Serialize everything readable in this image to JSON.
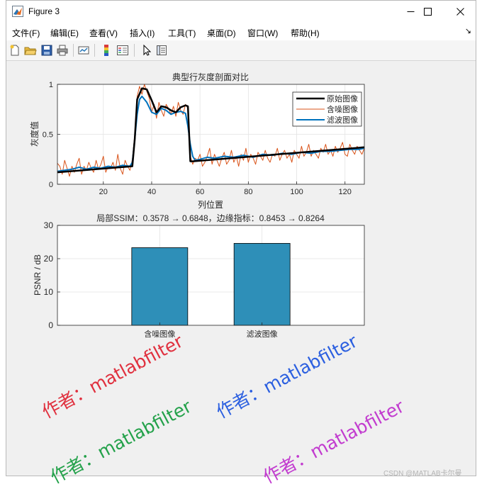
{
  "window": {
    "title": "Figure 3",
    "controls": [
      "minimize",
      "maximize",
      "close"
    ]
  },
  "menubar": {
    "items": [
      "文件(F)",
      "编辑(E)",
      "查看(V)",
      "插入(I)",
      "工具(T)",
      "桌面(D)",
      "窗口(W)",
      "帮助(H)"
    ],
    "overflow_glyph": "↘"
  },
  "toolbar": {
    "icons": [
      "new-figure-icon",
      "open-folder-icon",
      "save-icon",
      "print-icon",
      "link-icon",
      "colorbar-icon",
      "legend-icon",
      "pointer-icon",
      "property-editor-icon"
    ]
  },
  "colors": {
    "original": "#000000",
    "noisy": "#d95319",
    "filtered": "#0072bd",
    "bar": "#2e8fb8"
  },
  "chart_data": [
    {
      "type": "line",
      "title": "典型行灰度剖面对比",
      "xlabel": "列位置",
      "ylabel": "灰度值",
      "xlim": [
        1,
        128
      ],
      "ylim": [
        0,
        1
      ],
      "xticks": [
        20,
        40,
        60,
        80,
        100,
        120
      ],
      "yticks": [
        0,
        0.5,
        1
      ],
      "ytick_labels": [
        "0",
        "0.5",
        "1"
      ],
      "grid": true,
      "legend": {
        "position": "top-right",
        "entries": [
          "原始图像",
          "含噪图像",
          "滤波图像"
        ]
      },
      "series": [
        {
          "name": "原始图像",
          "x": [
            1,
            32,
            33,
            34,
            36,
            38,
            40,
            42,
            44,
            46,
            48,
            50,
            52,
            54,
            55,
            56,
            57,
            128
          ],
          "y": [
            0.12,
            0.18,
            0.45,
            0.85,
            0.96,
            0.95,
            0.84,
            0.72,
            0.78,
            0.77,
            0.74,
            0.72,
            0.77,
            0.79,
            0.78,
            0.23,
            0.23,
            0.37
          ]
        },
        {
          "name": "含噪图像",
          "x": [
            1,
            2,
            3,
            4,
            5,
            6,
            7,
            8,
            9,
            10,
            11,
            12,
            13,
            14,
            15,
            16,
            17,
            18,
            19,
            20,
            21,
            22,
            23,
            24,
            25,
            26,
            27,
            28,
            29,
            30,
            31,
            32,
            33,
            34,
            35,
            36,
            37,
            38,
            39,
            40,
            41,
            42,
            43,
            44,
            45,
            46,
            47,
            48,
            49,
            50,
            51,
            52,
            53,
            54,
            55,
            56,
            57,
            58,
            59,
            60,
            61,
            62,
            63,
            64,
            65,
            66,
            67,
            68,
            69,
            70,
            71,
            72,
            73,
            74,
            75,
            76,
            77,
            78,
            79,
            80,
            81,
            82,
            83,
            84,
            85,
            86,
            87,
            88,
            89,
            90,
            91,
            92,
            93,
            94,
            95,
            96,
            97,
            98,
            99,
            100,
            101,
            102,
            103,
            104,
            105,
            106,
            107,
            108,
            109,
            110,
            111,
            112,
            113,
            114,
            115,
            116,
            117,
            118,
            119,
            120,
            121,
            122,
            123,
            124,
            125,
            126,
            127,
            128
          ],
          "y": [
            0.21,
            0.18,
            0.1,
            0.24,
            0.16,
            0.08,
            0.18,
            0.12,
            0.2,
            0.26,
            0.1,
            0.18,
            0.14,
            0.22,
            0.16,
            0.12,
            0.24,
            0.15,
            0.2,
            0.28,
            0.12,
            0.18,
            0.16,
            0.22,
            0.14,
            0.3,
            0.16,
            0.1,
            0.24,
            0.18,
            0.14,
            0.25,
            0.5,
            0.88,
            0.98,
            0.9,
            1.0,
            0.93,
            0.86,
            0.72,
            0.8,
            0.66,
            0.82,
            0.74,
            0.68,
            0.8,
            0.76,
            0.7,
            0.78,
            0.68,
            0.82,
            0.74,
            0.7,
            0.8,
            0.76,
            0.28,
            0.2,
            0.26,
            0.24,
            0.3,
            0.18,
            0.22,
            0.28,
            0.36,
            0.2,
            0.3,
            0.24,
            0.18,
            0.26,
            0.32,
            0.2,
            0.24,
            0.34,
            0.22,
            0.28,
            0.18,
            0.3,
            0.24,
            0.36,
            0.22,
            0.3,
            0.26,
            0.2,
            0.32,
            0.28,
            0.24,
            0.34,
            0.26,
            0.22,
            0.3,
            0.28,
            0.36,
            0.24,
            0.3,
            0.34,
            0.26,
            0.3,
            0.22,
            0.34,
            0.3,
            0.26,
            0.38,
            0.28,
            0.32,
            0.4,
            0.28,
            0.34,
            0.3,
            0.26,
            0.36,
            0.32,
            0.4,
            0.3,
            0.34,
            0.28,
            0.38,
            0.32,
            0.36,
            0.42,
            0.3,
            0.28,
            0.4,
            0.34,
            0.3,
            0.38,
            0.34,
            0.3,
            0.36
          ]
        },
        {
          "name": "滤波图像",
          "x": [
            1,
            4,
            7,
            10,
            13,
            16,
            19,
            22,
            25,
            28,
            31,
            32,
            33,
            34,
            35,
            36,
            38,
            40,
            42,
            44,
            46,
            48,
            50,
            52,
            54,
            55,
            56,
            57,
            58,
            60,
            63,
            66,
            70,
            74,
            78,
            82,
            86,
            90,
            94,
            98,
            102,
            106,
            110,
            114,
            118,
            122,
            126,
            128
          ],
          "y": [
            0.13,
            0.14,
            0.15,
            0.17,
            0.15,
            0.17,
            0.16,
            0.18,
            0.17,
            0.19,
            0.18,
            0.22,
            0.45,
            0.7,
            0.85,
            0.88,
            0.82,
            0.72,
            0.7,
            0.76,
            0.74,
            0.7,
            0.72,
            0.73,
            0.71,
            0.58,
            0.4,
            0.28,
            0.24,
            0.25,
            0.27,
            0.26,
            0.28,
            0.27,
            0.29,
            0.27,
            0.3,
            0.29,
            0.31,
            0.3,
            0.32,
            0.31,
            0.33,
            0.33,
            0.34,
            0.35,
            0.35,
            0.36
          ]
        }
      ]
    },
    {
      "type": "bar",
      "title": "局部SSIM：0.3578 → 0.6848，边缘指标：0.8453 → 0.8264",
      "xlabel": "",
      "ylabel": "PSNR / dB",
      "categories": [
        "含噪图像",
        "滤波图像"
      ],
      "values": [
        23.3,
        24.6
      ],
      "ylim": [
        0,
        30
      ],
      "yticks": [
        0,
        10,
        20,
        30
      ],
      "grid": true
    }
  ],
  "watermarks": [
    {
      "text": "作者：matlabfilter",
      "color": "#e0303e"
    },
    {
      "text": "作者：matlabfilter",
      "color": "#2b5fe0"
    },
    {
      "text": "作者：matlabfilter",
      "color": "#23a14a"
    },
    {
      "text": "作者：matlabfilter",
      "color": "#c23ccf"
    }
  ],
  "credit": "CSDN @MATLAB卡尔曼"
}
